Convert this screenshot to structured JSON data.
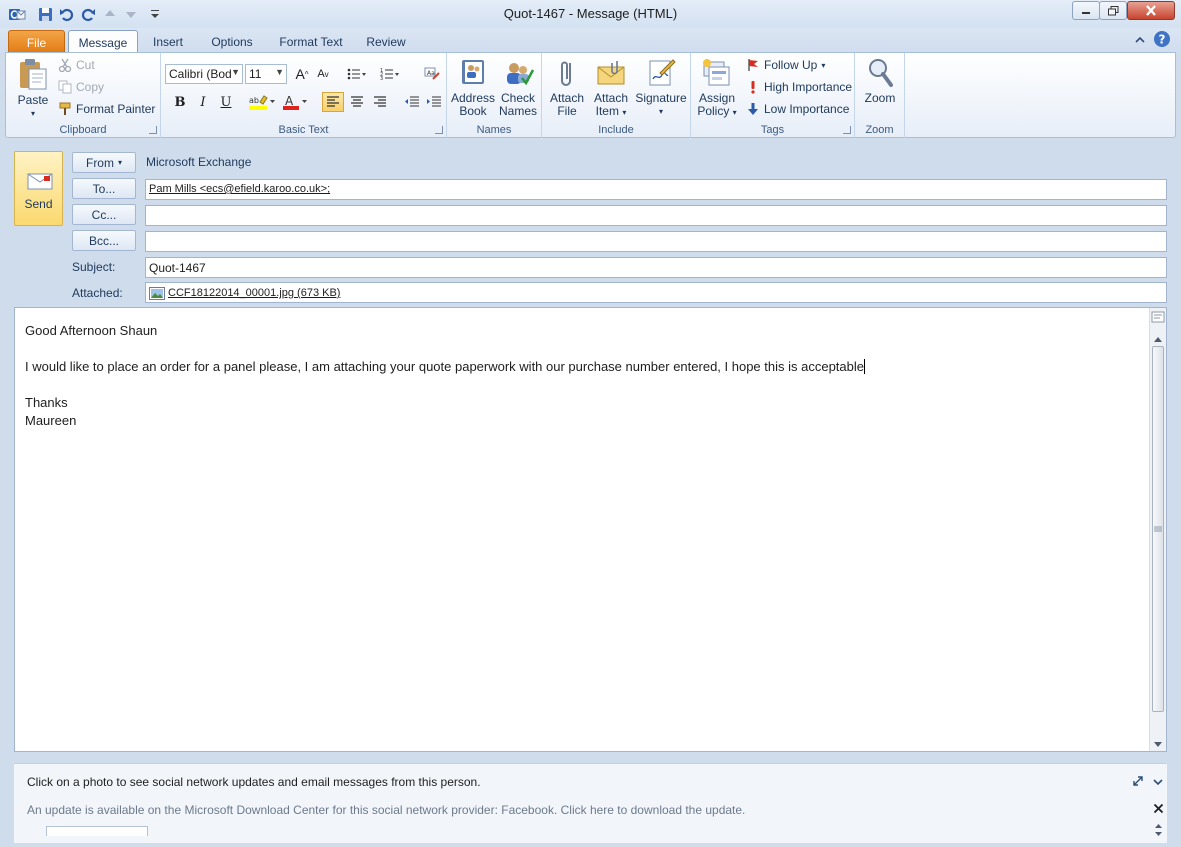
{
  "window": {
    "title": "Quot-1467  -  Message (HTML)"
  },
  "tabs": [
    {
      "label": "File"
    },
    {
      "label": "Message"
    },
    {
      "label": "Insert"
    },
    {
      "label": "Options"
    },
    {
      "label": "Format Text"
    },
    {
      "label": "Review"
    }
  ],
  "ribbon": {
    "clipboard": {
      "label": "Clipboard",
      "paste": "Paste",
      "cut": "Cut",
      "copy": "Copy",
      "format_painter": "Format Painter"
    },
    "basic_text": {
      "label": "Basic Text",
      "font": "Calibri (Bod",
      "size": "11"
    },
    "names": {
      "label": "Names",
      "address_book_1": "Address",
      "address_book_2": "Book",
      "check_names_1": "Check",
      "check_names_2": "Names"
    },
    "include": {
      "label": "Include",
      "attach_file_1": "Attach",
      "attach_file_2": "File",
      "attach_item_1": "Attach",
      "attach_item_2": "Item",
      "signature": "Signature"
    },
    "tags": {
      "label": "Tags",
      "assign_policy_1": "Assign",
      "assign_policy_2": "Policy",
      "follow_up": "Follow Up",
      "high_importance": "High Importance",
      "low_importance": "Low Importance"
    },
    "zoom": {
      "label": "Zoom",
      "zoom": "Zoom"
    }
  },
  "header": {
    "send": "Send",
    "from_button": "From",
    "from_value": "Microsoft Exchange",
    "to_button": "To...",
    "to_value": "Pam Mills <ecs@efield.karoo.co.uk>;",
    "cc_button": "Cc...",
    "cc_value": "",
    "bcc_button": "Bcc...",
    "bcc_value": "",
    "subject_label": "Subject:",
    "subject_value": "Quot-1467",
    "attached_label": "Attached:",
    "attachment": "CCF18122014_00001.jpg (673 KB)"
  },
  "body": {
    "greeting": "Good Afternoon Shaun",
    "paragraph": "I would like to place an order for a panel please, I am attaching your quote paperwork with our purchase number entered, I hope this is acceptable",
    "closing": "Thanks",
    "signature": "Maureen"
  },
  "people_pane": {
    "hint": "Click on a photo to see social network updates and email messages from this person.",
    "update": "An update is available on the Microsoft Download Center for this social network provider: Facebook. Click here to download the update."
  },
  "colors": {
    "file_tab": "#e37d15",
    "send_button": "#fbd96f",
    "ribbon_border": "#a8bfdc"
  }
}
